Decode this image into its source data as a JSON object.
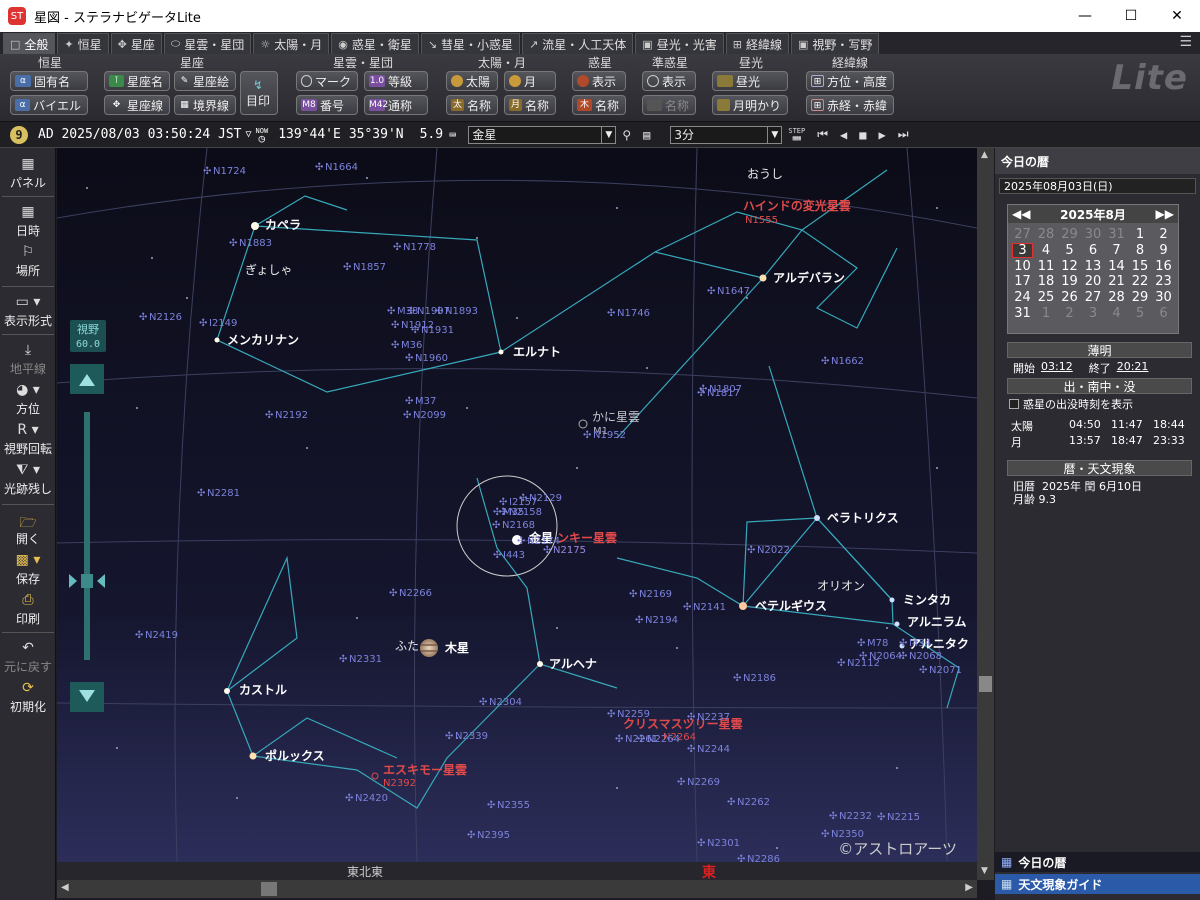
{
  "window": {
    "title": "星図 - ステラナビゲータLite",
    "app_icon": "app-icon"
  },
  "tabs": [
    {
      "label": "全般",
      "icon": "panel-icon"
    },
    {
      "label": "恒星",
      "icon": "star-icon"
    },
    {
      "label": "星座",
      "icon": "constellation-icon"
    },
    {
      "label": "星雲・星団",
      "icon": "nebula-icon"
    },
    {
      "label": "太陽・月",
      "icon": "sun-icon"
    },
    {
      "label": "惑星・衛星",
      "icon": "planet-icon"
    },
    {
      "label": "彗星・小惑星",
      "icon": "comet-icon"
    },
    {
      "label": "流星・人工天体",
      "icon": "meteor-icon"
    },
    {
      "label": "昼光・光害",
      "icon": "daylight-icon"
    },
    {
      "label": "経緯線",
      "icon": "grid-icon"
    },
    {
      "label": "視野・写野",
      "icon": "fov-icon"
    }
  ],
  "ribbon": {
    "groups": {
      "star": "恒星",
      "constellation": "星座",
      "nebula": "星雲・星団",
      "sunmoon": "太陽・月",
      "planet": "惑星",
      "dwarf": "準惑星",
      "daylight": "昼光",
      "grid": "経緯線"
    },
    "star": {
      "proper_name": "固有名",
      "bayer": "バイエル"
    },
    "constellation": {
      "name": "星座名",
      "art": "星座絵",
      "lines": "星座線",
      "boundary": "境界線",
      "landmark": "目印"
    },
    "nebula": {
      "mark": "マーク",
      "magnitude": "等級",
      "number": "番号",
      "common": "通称"
    },
    "sunmoon": {
      "sun": "太陽",
      "moon": "月",
      "name1": "名称",
      "name2": "名称"
    },
    "planet": {
      "show": "表示",
      "name": "名称"
    },
    "dwarf": {
      "show": "表示",
      "name": "名称"
    },
    "daylight": {
      "daylight": "昼光",
      "moonlight": "月明かり"
    },
    "grid": {
      "altaz": "方位・高度",
      "radec": "赤経・赤緯"
    },
    "logo": "Lite"
  },
  "timebar": {
    "badge": "9",
    "datetime": "AD 2025/08/03 03:50:24 JST",
    "tz_caret": "▽",
    "now_label": "NOW",
    "longitude": "139°44'E",
    "latitude": "35°39'N",
    "elevation": "5.9",
    "target": "金星",
    "step": "3分",
    "step_label": "STEP"
  },
  "lefttool": [
    {
      "label": "パネル",
      "icon": "panel-icon"
    },
    {
      "label": "日時",
      "icon": "calendar-icon"
    },
    {
      "label": "場所",
      "icon": "location-icon"
    },
    {
      "label": "表示形式",
      "icon": "display-icon"
    },
    {
      "label": "地平線",
      "icon": "horizon-icon",
      "disabled": true
    },
    {
      "label": "方位",
      "icon": "compass-icon"
    },
    {
      "label": "視野回転",
      "icon": "rotate-icon"
    },
    {
      "label": "光跡残し",
      "icon": "trail-icon"
    },
    {
      "label": "開く",
      "icon": "folder-icon"
    },
    {
      "label": "保存",
      "icon": "save-icon"
    },
    {
      "label": "印刷",
      "icon": "print-icon"
    },
    {
      "label": "元に戻す",
      "icon": "undo-icon",
      "disabled": true
    },
    {
      "label": "初期化",
      "icon": "reset-icon"
    }
  ],
  "fov": {
    "label": "視野",
    "value": "60.0"
  },
  "sky": {
    "stars": [
      {
        "id": "capella",
        "label": "カペラ"
      },
      {
        "id": "menkalinan",
        "label": "メンカリナン"
      },
      {
        "id": "elnath",
        "label": "エルナト"
      },
      {
        "id": "aldebaran",
        "label": "アルデバラン"
      },
      {
        "id": "bellatrix",
        "label": "ベラトリクス"
      },
      {
        "id": "betelgeuse",
        "label": "ベテルギウス"
      },
      {
        "id": "mintaka",
        "label": "ミンタカ"
      },
      {
        "id": "alnilam",
        "label": "アルニラム"
      },
      {
        "id": "alnitak",
        "label": "アルニタク"
      },
      {
        "id": "alhena",
        "label": "アルヘナ"
      },
      {
        "id": "castor",
        "label": "カストル"
      },
      {
        "id": "pollux",
        "label": "ポルックス"
      }
    ],
    "constellations": [
      {
        "id": "ohshi",
        "label": "おうし"
      },
      {
        "id": "gyosha",
        "label": "ぎょしゃ"
      },
      {
        "id": "orion",
        "label": "オリオン"
      },
      {
        "id": "futago",
        "label": "ふた"
      }
    ],
    "planets": [
      {
        "id": "venus",
        "label": "金星"
      },
      {
        "id": "jupiter",
        "label": "木星"
      }
    ],
    "named_objects": [
      {
        "id": "hind",
        "label": "ハインドの変光星雲",
        "sub": "N1555"
      },
      {
        "id": "crab",
        "label": "かに星雲",
        "sub": "M1"
      },
      {
        "id": "monkey",
        "label": "ンキー星雲",
        "sub": "N2175"
      },
      {
        "id": "eskimo",
        "label": "エスキモー星雲",
        "sub": "N2392"
      },
      {
        "id": "jellyfish",
        "label": "クリスマスツリー星雲",
        "sub": "N2264"
      }
    ],
    "dso": [
      "N1724",
      "N1664",
      "N1883",
      "N1778",
      "N1857",
      "N2126",
      "I2149",
      "M38",
      "N1907",
      "N1893",
      "N1912",
      "N1931",
      "M36",
      "N1960",
      "N1746",
      "N1647",
      "N1662",
      "N1807",
      "N1817",
      "N2192",
      "M37",
      "N2099",
      "N1952",
      "N2281",
      "N2129",
      "I2157",
      "M35",
      "N2158",
      "N2168",
      "N2174",
      "N2175",
      "I443",
      "N2022",
      "N2266",
      "N2169",
      "N2141",
      "N2194",
      "M78",
      "N2064",
      "N2068",
      "N2071",
      "N2112",
      "N2186",
      "I434",
      "N2419",
      "N2331",
      "N2304",
      "N2339",
      "N2259",
      "N2261",
      "N2264",
      "N2237",
      "N2244",
      "N2269",
      "N2262",
      "N2232",
      "N2215",
      "N2350",
      "N2355",
      "N2395",
      "N2420",
      "N2301",
      "N2286"
    ],
    "directions": {
      "left": "東北東",
      "center": "東"
    },
    "credit": "©アストロアーツ"
  },
  "rpanel": {
    "title": "今日の暦",
    "date": "2025年08月03日(日)",
    "calendar": {
      "month_label": "2025年8月",
      "weeks": [
        [
          "27",
          "28",
          "29",
          "30",
          "31",
          "1",
          "2"
        ],
        [
          "3",
          "4",
          "5",
          "6",
          "7",
          "8",
          "9"
        ],
        [
          "10",
          "11",
          "12",
          "13",
          "14",
          "15",
          "16"
        ],
        [
          "17",
          "18",
          "19",
          "20",
          "21",
          "22",
          "23"
        ],
        [
          "24",
          "25",
          "26",
          "27",
          "28",
          "29",
          "30"
        ],
        [
          "31",
          "1",
          "2",
          "3",
          "4",
          "5",
          "6"
        ]
      ]
    },
    "twilight": {
      "title": "薄明",
      "start_label": "開始",
      "start": "03:12",
      "end_label": "終了",
      "end": "20:21"
    },
    "rise_set": {
      "title": "出・南中・没",
      "checkbox": "惑星の出没時刻を表示",
      "rows": [
        {
          "name": "太陽",
          "rise": "04:50",
          "transit": "11:47",
          "set": "18:44"
        },
        {
          "name": "月",
          "rise": "13:57",
          "transit": "18:47",
          "set": "23:33"
        }
      ]
    },
    "events": {
      "title": "暦・天文現象",
      "lunar": "旧暦  2025年 閏 6月10日",
      "moon_age": "月齢 9.3"
    },
    "bottom1": "今日の暦",
    "bottom2": "天文現象ガイド"
  },
  "colors": {
    "sky_top": "#0d0d1a",
    "sky_bottom": "#2a2c55",
    "constellation_line": "#3fb6c6",
    "dso": "#7a7fd8",
    "highlight": "#d83838"
  }
}
